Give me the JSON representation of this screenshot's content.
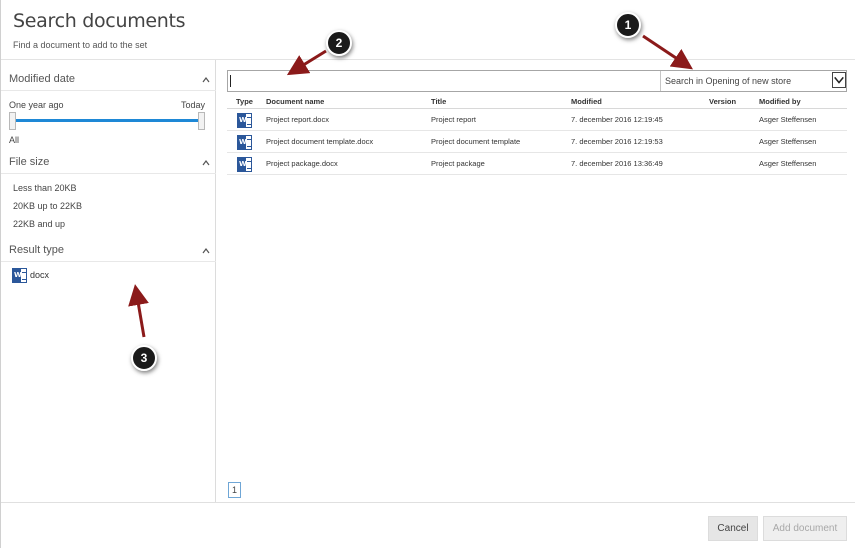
{
  "header": {
    "title": "Search documents",
    "subtitle": "Find a document to add to the set"
  },
  "filters": {
    "modified_date": {
      "title": "Modified date",
      "from_label": "One year ago",
      "to_label": "Today",
      "all_label": "All"
    },
    "file_size": {
      "title": "File size",
      "options": [
        "Less than 20KB",
        "20KB up to 22KB",
        "22KB and up"
      ]
    },
    "result_type": {
      "title": "Result type",
      "options": [
        {
          "label": "docx",
          "icon": "word-document-icon"
        }
      ]
    }
  },
  "search": {
    "value": "",
    "scope": "Search in Opening of new store"
  },
  "table": {
    "headers": {
      "type": "Type",
      "name": "Document name",
      "title": "Title",
      "modified": "Modified",
      "version": "Version",
      "modified_by": "Modified by"
    },
    "rows": [
      {
        "icon": "word-document-icon",
        "name": "Project report.docx",
        "title": "Project report",
        "modified": "7. december 2016 12:19:45",
        "version": "",
        "modified_by": "Asger Steffensen"
      },
      {
        "icon": "word-document-icon",
        "name": "Project document template.docx",
        "title": "Project document template",
        "modified": "7. december 2016 12:19:53",
        "version": "",
        "modified_by": "Asger Steffensen"
      },
      {
        "icon": "word-document-icon",
        "name": "Project package.docx",
        "title": "Project package",
        "modified": "7. december 2016 13:36:49",
        "version": "",
        "modified_by": "Asger Steffensen"
      }
    ]
  },
  "pagination": {
    "current_page": "1"
  },
  "footer": {
    "cancel_label": "Cancel",
    "add_label": "Add document"
  },
  "annotations": [
    "1",
    "2",
    "3"
  ],
  "colors": {
    "accent": "#1e88d6",
    "word_blue": "#2b579a",
    "arrow_red": "#8b1a1a"
  }
}
